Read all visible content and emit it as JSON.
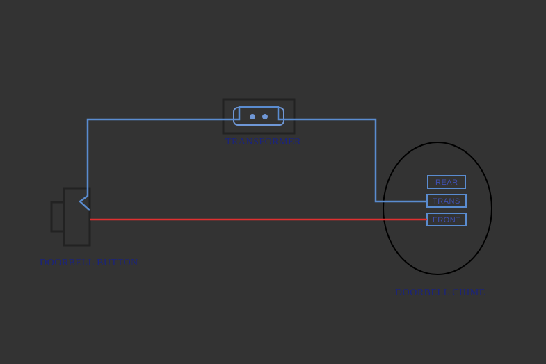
{
  "labels": {
    "transformer": "TRANSFORMER",
    "doorbell_button": "DOORBELL BUTTON",
    "doorbell_chime": "DOORBELL CHIME"
  },
  "terminals": {
    "rear": "REAR",
    "trans": "TRANS",
    "front": "FRONT"
  },
  "wires": {
    "blue": "#5a8cd0",
    "red": "#e03030"
  }
}
